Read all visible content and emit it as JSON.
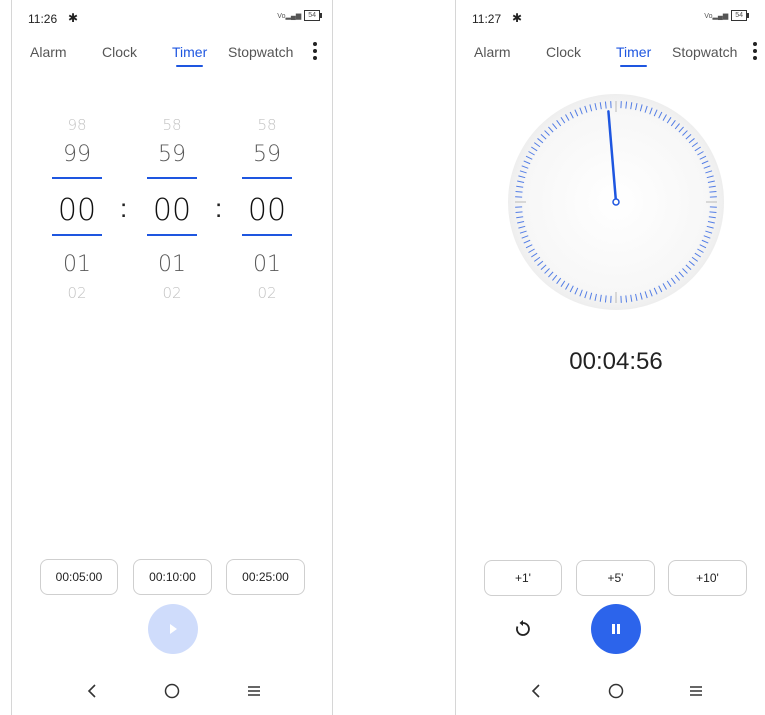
{
  "left": {
    "status_time": "11:26",
    "tabs": [
      "Alarm",
      "Clock",
      "Timer",
      "Stopwatch"
    ],
    "active_tab": "Timer",
    "picker": {
      "hours": [
        "98",
        "99",
        "00",
        "01",
        "02"
      ],
      "minutes": [
        "58",
        "59",
        "00",
        "01",
        "02"
      ],
      "seconds": [
        "58",
        "59",
        "00",
        "01",
        "02"
      ],
      "separator": ":"
    },
    "presets": [
      "00:05:00",
      "00:10:00",
      "00:25:00"
    ],
    "play_enabled": false
  },
  "right": {
    "status_time": "11:27",
    "tabs": [
      "Alarm",
      "Clock",
      "Timer",
      "Stopwatch"
    ],
    "active_tab": "Timer",
    "remaining": "00:04:56",
    "remaining_fraction": 0.9867,
    "add_buttons": [
      "+1'",
      "+5'",
      "+10'"
    ],
    "running": true
  },
  "status_icons": {
    "signal": "Vo LTE signal",
    "battery": "54"
  },
  "colors": {
    "accent": "#1e56e0",
    "fab_active": "#2c64eb",
    "fab_disabled": "#cfdcfb"
  },
  "icons": {
    "settings": "gear-icon",
    "menu": "more-vert-icon",
    "play": "play-icon",
    "pause": "pause-icon",
    "reset": "reset-icon",
    "back": "back-icon",
    "home": "home-icon",
    "recents": "recents-icon"
  }
}
